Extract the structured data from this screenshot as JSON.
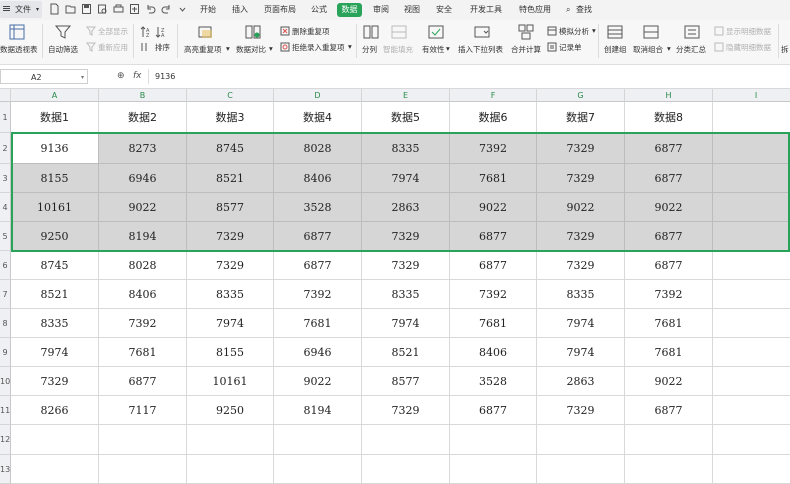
{
  "menubar": {
    "file_label": "文件",
    "tabs": [
      "开始",
      "插入",
      "页面布局",
      "公式",
      "数据",
      "审阅",
      "视图",
      "安全",
      "开发工具",
      "特色应用",
      "查找"
    ],
    "active_tab": "数据"
  },
  "ribbon": {
    "pivot": "数据透视表",
    "autofilter": "自动筛选",
    "show_all": "全部显示",
    "reapply": "重新应用",
    "sort": "排序",
    "highlight_dup": "高亮重复项",
    "compare": "数据对比",
    "remove_dup": "删除重复项",
    "reject_dup": "拒绝录入重复项",
    "split": "分列",
    "smart_fill": "智能填充",
    "validity": "有效性",
    "dropdown": "插入下拉列表",
    "consolidate": "合并计算",
    "simulate": "模拟分析",
    "record_form": "记录单",
    "group": "创建组",
    "ungroup": "取消组合",
    "subtotal": "分类汇总",
    "show_detail": "显示明细数据",
    "hide_detail": "隐藏明细数据",
    "more": "拆"
  },
  "formula_bar": {
    "cell_ref": "A2",
    "fx": "fx",
    "value": "9136"
  },
  "sheet": {
    "columns": [
      "A",
      "B",
      "C",
      "D",
      "E",
      "F",
      "G",
      "H",
      "I"
    ],
    "row_numbers": [
      "1",
      "2",
      "3",
      "4",
      "5",
      "6",
      "7",
      "8",
      "9",
      "10",
      "11",
      "12",
      "13"
    ],
    "header_row": [
      "数据1",
      "数据2",
      "数据3",
      "数据4",
      "数据5",
      "数据6",
      "数据7",
      "数据8"
    ],
    "rows": [
      [
        "9136",
        "8273",
        "8745",
        "8028",
        "8335",
        "7392",
        "7329",
        "6877"
      ],
      [
        "8155",
        "6946",
        "8521",
        "8406",
        "7974",
        "7681",
        "7329",
        "6877"
      ],
      [
        "10161",
        "9022",
        "8577",
        "3528",
        "2863",
        "9022",
        "9022",
        "9022"
      ],
      [
        "9250",
        "8194",
        "7329",
        "6877",
        "7329",
        "6877",
        "7329",
        "6877"
      ],
      [
        "8745",
        "8028",
        "7329",
        "6877",
        "7329",
        "6877",
        "7329",
        "6877"
      ],
      [
        "8521",
        "8406",
        "8335",
        "7392",
        "8335",
        "7392",
        "8335",
        "7392"
      ],
      [
        "8335",
        "7392",
        "7974",
        "7681",
        "7974",
        "7681",
        "7974",
        "7681"
      ],
      [
        "7974",
        "7681",
        "8155",
        "6946",
        "8521",
        "8406",
        "7974",
        "7681"
      ],
      [
        "7329",
        "6877",
        "10161",
        "9022",
        "8577",
        "3528",
        "2863",
        "9022"
      ],
      [
        "8266",
        "7117",
        "9250",
        "8194",
        "7329",
        "6877",
        "7329",
        "6877"
      ]
    ],
    "selected_range": "A2:I5",
    "active_cell": "A2"
  },
  "colors": {
    "accent": "#2aa35a",
    "selection_fill": "#d6d6d6"
  }
}
